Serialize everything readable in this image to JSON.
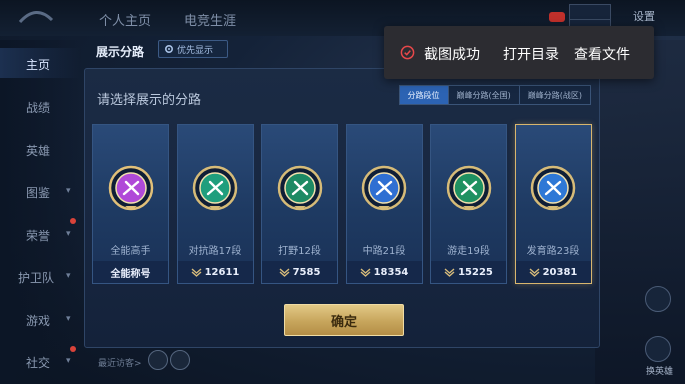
{
  "topbar": {
    "tabs": [
      "个人主页",
      "电竞生涯"
    ],
    "settings_label": "设置"
  },
  "sidebar": {
    "items": [
      {
        "label": "主页",
        "active": true
      },
      {
        "label": "战绩"
      },
      {
        "label": "英雄"
      },
      {
        "label": "图鉴"
      },
      {
        "label": "荣誉"
      },
      {
        "label": "护卫队"
      },
      {
        "label": "游戏"
      },
      {
        "label": "社交"
      }
    ]
  },
  "panel": {
    "title": "展示分路",
    "pref_button": "优先显示",
    "subtitle": "请选择展示的分路",
    "tabs": [
      "分路段位",
      "巅峰分路(全国)",
      "巅峰分路(战区)"
    ],
    "active_tab": 0,
    "confirm_label": "确定",
    "cards": [
      {
        "label": "全能高手",
        "bottom": "全能称号",
        "has_value": false,
        "selected": false,
        "color": "#b04ad8",
        "ring": "#e1c079"
      },
      {
        "label": "对抗路17段",
        "bottom": "12611",
        "has_value": true,
        "selected": false,
        "color": "#1f9e7d",
        "ring": "#d6bb78"
      },
      {
        "label": "打野12段",
        "bottom": "7585",
        "has_value": true,
        "selected": false,
        "color": "#1d8a64",
        "ring": "#d6bb78"
      },
      {
        "label": "中路21段",
        "bottom": "18354",
        "has_value": true,
        "selected": false,
        "color": "#2f6fd2",
        "ring": "#d6bb78"
      },
      {
        "label": "游走19段",
        "bottom": "15225",
        "has_value": true,
        "selected": false,
        "color": "#1f9161",
        "ring": "#d6bb78"
      },
      {
        "label": "发育路23段",
        "bottom": "20381",
        "has_value": true,
        "selected": true,
        "color": "#2e78d6",
        "ring": "#d6bb78"
      }
    ]
  },
  "toast": {
    "message": "截图成功",
    "open_dir": "打开目录",
    "view_file": "查看文件"
  },
  "bottom": {
    "recent": "最近访客>"
  },
  "right_panel": {
    "label": "换英雄"
  }
}
